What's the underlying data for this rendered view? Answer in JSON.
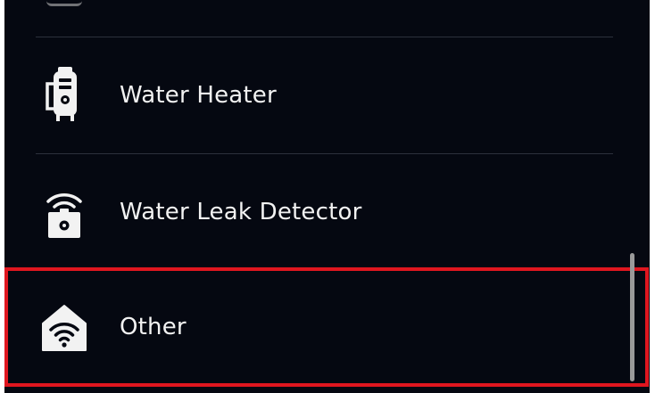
{
  "list": {
    "items": [
      {
        "label": "Water Heater",
        "icon": "water-heater-icon"
      },
      {
        "label": "Water Leak Detector",
        "icon": "water-leak-detector-icon"
      },
      {
        "label": "Other",
        "icon": "other-device-icon",
        "selected": true
      }
    ]
  },
  "colors": {
    "background": "#050811",
    "text": "#f2f2f2",
    "divider": "#2c313c",
    "selection": "#e0161f",
    "scrollbar": "#9a9a9a"
  }
}
